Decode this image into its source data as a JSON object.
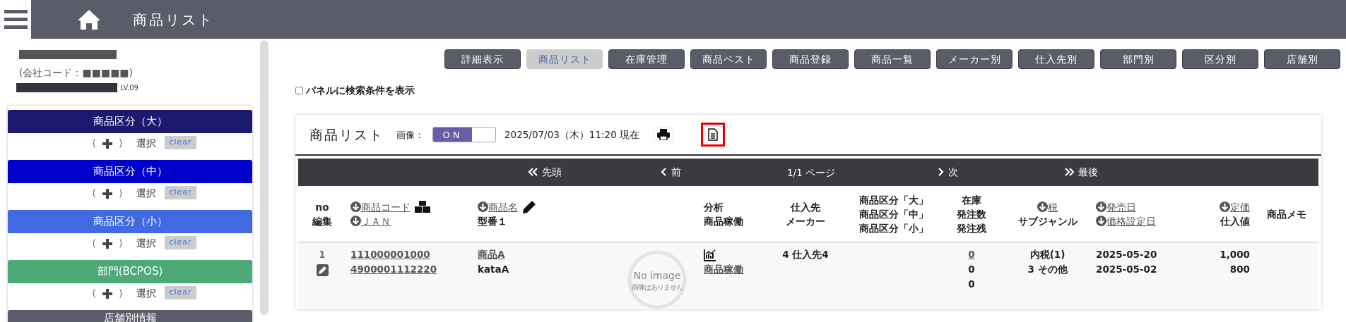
{
  "header": {
    "title": "商品リスト"
  },
  "sidebar": {
    "company_code": "(会社コード：■■■■■)",
    "level": "LV.09",
    "filters": [
      {
        "title": "商品区分（大）",
        "color": "#1b1a6e",
        "add_open": "(",
        "add_close": ")",
        "select": "選択",
        "clear": "clear"
      },
      {
        "title": "商品区分（中）",
        "color": "#0000cd",
        "add_open": "(",
        "add_close": ")",
        "select": "選択",
        "clear": "clear"
      },
      {
        "title": "商品区分（小）",
        "color": "#4169e1",
        "add_open": "(",
        "add_close": ")",
        "select": "選択",
        "clear": "clear"
      },
      {
        "title": "部門(BCPOS)",
        "color": "#4caa78",
        "add_open": "(",
        "add_close": ")",
        "select": "選択",
        "clear": "clear"
      }
    ],
    "section": "店舗別情報"
  },
  "toolbar": [
    {
      "label": "詳細表示",
      "selected": false
    },
    {
      "label": "商品リスト",
      "selected": true
    },
    {
      "label": "在庫管理",
      "selected": false
    },
    {
      "label": "商品ベスト",
      "selected": false
    },
    {
      "label": "商品登録",
      "selected": false
    },
    {
      "label": "商品一覧",
      "selected": false
    },
    {
      "label": "メーカー別",
      "selected": false
    },
    {
      "label": "仕入先別",
      "selected": false
    },
    {
      "label": "部門別",
      "selected": false
    },
    {
      "label": "区分別",
      "selected": false
    },
    {
      "label": "店舗別",
      "selected": false
    }
  ],
  "search_panel_checkbox": {
    "label": "パネルに検索条件を表示",
    "checked": false
  },
  "panel": {
    "title": "商品リスト",
    "image_label": "画像：",
    "image_toggle": {
      "label": "ON",
      "on": true
    },
    "timestamp": "2025/07/03（木）11:20 現在"
  },
  "pager": {
    "first": "先頭",
    "prev": "前",
    "page": "1/1 ページ",
    "next": "次",
    "last": "最後"
  },
  "table": {
    "columns": [
      {
        "lines": [
          {
            "text": "no",
            "sort": false
          },
          {
            "text": "編集",
            "sort": false
          }
        ]
      },
      {
        "lines": [
          {
            "text": "商品コード",
            "sort": true
          },
          {
            "text": "ＪＡＮ",
            "sort": true
          }
        ]
      },
      {
        "lines": [
          {
            "text": "商品名",
            "sort": true
          },
          {
            "text": "型番１",
            "sort": false
          }
        ]
      },
      {},
      {
        "lines": [
          {
            "text": "分析",
            "sort": false
          },
          {
            "text": "商品稼働",
            "sort": false
          }
        ]
      },
      {
        "lines": [
          {
            "text": "仕入先",
            "sort": false
          },
          {
            "text": "メーカー",
            "sort": false
          }
        ]
      },
      {
        "lines": [
          {
            "text": "商品区分「大」",
            "sort": false
          },
          {
            "text": "商品区分「中」",
            "sort": false
          },
          {
            "text": "商品区分「小」",
            "sort": false
          }
        ]
      },
      {
        "lines": [
          {
            "text": "在庫",
            "sort": false
          },
          {
            "text": "発注数",
            "sort": false
          },
          {
            "text": "発注残",
            "sort": false
          }
        ]
      },
      {
        "lines": [
          {
            "text": "税",
            "sort": true
          },
          {
            "text": "サブジャンル",
            "sort": false
          }
        ]
      },
      {
        "lines": [
          {
            "text": "発売日",
            "sort": true
          },
          {
            "text": "価格設定日",
            "sort": true
          }
        ]
      },
      {
        "lines": [
          {
            "text": "定価",
            "sort": true
          },
          {
            "text": "仕入値",
            "sort": false
          }
        ]
      },
      {
        "lines": [
          {
            "text": "商品メモ",
            "sort": false
          }
        ]
      }
    ],
    "rows": [
      {
        "cells": [
          [
            {
              "text": "1"
            }
          ],
          [
            {
              "text": "111000001000",
              "link": true
            },
            {
              "text": "4900001112220",
              "link": true
            }
          ],
          [
            {
              "text": "商品A",
              "link": true
            },
            {
              "text": "kataA"
            }
          ],
          [
            {
              "text": "No image"
            },
            {
              "text": "画像はありません"
            }
          ],
          [
            {
              "text": "商品稼働",
              "link": true
            }
          ],
          [
            {
              "text": "4 仕入先4"
            }
          ],
          [],
          [
            {
              "text": "0",
              "link": true
            },
            {
              "text": "0"
            },
            {
              "text": "0"
            }
          ],
          [
            {
              "text": "内税(1)"
            },
            {
              "text": "3 その他"
            }
          ],
          [
            {
              "text": "2025-05-20"
            },
            {
              "text": "2025-05-02"
            }
          ],
          [
            {
              "text": "1,000"
            },
            {
              "text": "800"
            }
          ],
          []
        ]
      }
    ]
  }
}
